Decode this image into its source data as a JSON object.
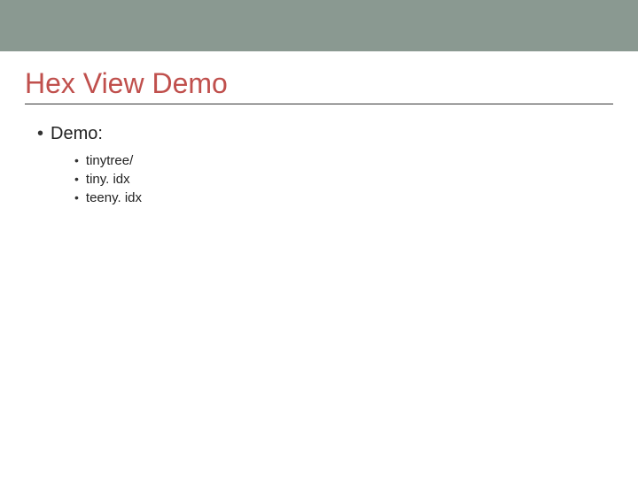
{
  "slide": {
    "title": "Hex View Demo",
    "level1": {
      "label": "Demo:",
      "items": [
        {
          "label": "tinytree/"
        },
        {
          "label": "tiny. idx"
        },
        {
          "label": "teeny. idx"
        }
      ]
    }
  }
}
